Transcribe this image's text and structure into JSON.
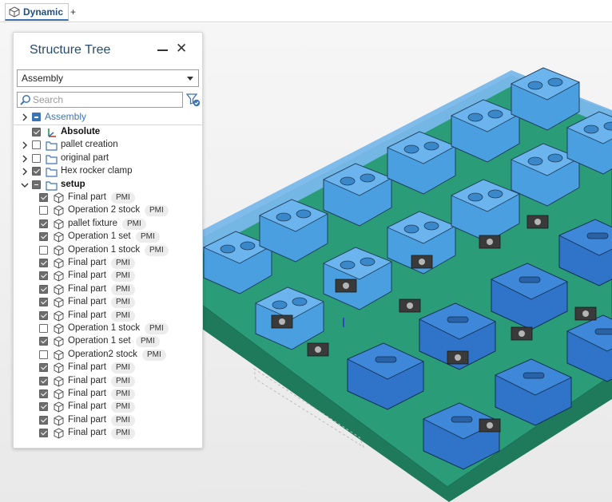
{
  "tab": {
    "label": "Dynamic",
    "add": "+"
  },
  "panel": {
    "title": "Structure Tree",
    "dropdown_value": "Assembly",
    "search_placeholder": "Search",
    "root": {
      "label": "Assembly"
    },
    "items": [
      {
        "label": "Absolute",
        "bold": true,
        "checked": "on",
        "icon": "coordinate-system-icon",
        "indent": 1,
        "chevron": ""
      },
      {
        "label": "pallet creation",
        "checked": "off",
        "icon": "folder-icon",
        "indent": 1,
        "chevron": "right"
      },
      {
        "label": "original part",
        "checked": "off",
        "icon": "folder-icon",
        "indent": 1,
        "chevron": "right"
      },
      {
        "label": "Hex rocker clamp",
        "checked": "on",
        "icon": "folder-icon",
        "indent": 1,
        "chevron": "right"
      },
      {
        "label": "setup",
        "bold": true,
        "checked": "mixed",
        "icon": "folder-icon",
        "indent": 1,
        "chevron": "down"
      },
      {
        "label": "Final part",
        "pmi": "PMI",
        "checked": "on",
        "icon": "part-icon",
        "indent": 2
      },
      {
        "label": "Operation 2 stock",
        "pmi": "PMI",
        "checked": "off",
        "icon": "part-icon",
        "indent": 2
      },
      {
        "label": "pallet fixture",
        "pmi": "PMI",
        "checked": "on",
        "icon": "part-icon",
        "indent": 2
      },
      {
        "label": "Operation 1 set",
        "pmi": "PMI",
        "checked": "on",
        "icon": "part-icon",
        "indent": 2
      },
      {
        "label": "Operation 1 stock",
        "pmi": "PMI",
        "checked": "off",
        "icon": "part-icon",
        "indent": 2
      },
      {
        "label": "Final part",
        "pmi": "PMI",
        "checked": "on",
        "icon": "part-icon",
        "indent": 2
      },
      {
        "label": "Final part",
        "pmi": "PMI",
        "checked": "on",
        "icon": "part-icon",
        "indent": 2
      },
      {
        "label": "Final part",
        "pmi": "PMI",
        "checked": "on",
        "icon": "part-icon",
        "indent": 2
      },
      {
        "label": "Final part",
        "pmi": "PMI",
        "checked": "on",
        "icon": "part-icon",
        "indent": 2
      },
      {
        "label": "Final part",
        "pmi": "PMI",
        "checked": "on",
        "icon": "part-icon",
        "indent": 2
      },
      {
        "label": "Operation 1 stock",
        "pmi": "PMI",
        "checked": "off",
        "icon": "part-icon",
        "indent": 2
      },
      {
        "label": "Operation 1 set",
        "pmi": "PMI",
        "checked": "on",
        "icon": "part-icon",
        "indent": 2
      },
      {
        "label": "Operation2 stock",
        "pmi": "PMI",
        "checked": "off",
        "icon": "part-icon",
        "indent": 2
      },
      {
        "label": "Final part",
        "pmi": "PMI",
        "checked": "on",
        "icon": "part-icon",
        "indent": 2
      },
      {
        "label": "Final part",
        "pmi": "PMI",
        "checked": "on",
        "icon": "part-icon",
        "indent": 2
      },
      {
        "label": "Final part",
        "pmi": "PMI",
        "checked": "on",
        "icon": "part-icon",
        "indent": 2
      },
      {
        "label": "Final part",
        "pmi": "PMI",
        "checked": "on",
        "icon": "part-icon",
        "indent": 2
      },
      {
        "label": "Final part",
        "pmi": "PMI",
        "checked": "on",
        "icon": "part-icon",
        "indent": 2
      },
      {
        "label": "Final part",
        "pmi": "PMI",
        "checked": "on",
        "icon": "part-icon",
        "indent": 2
      }
    ]
  },
  "colors": {
    "plate_green": "#2a9d78",
    "plate_dark": "#1f7a5c",
    "part_light_blue": "#4a9fe0",
    "part_dark_blue": "#2f74c8",
    "accent": "#1f4e8c"
  }
}
